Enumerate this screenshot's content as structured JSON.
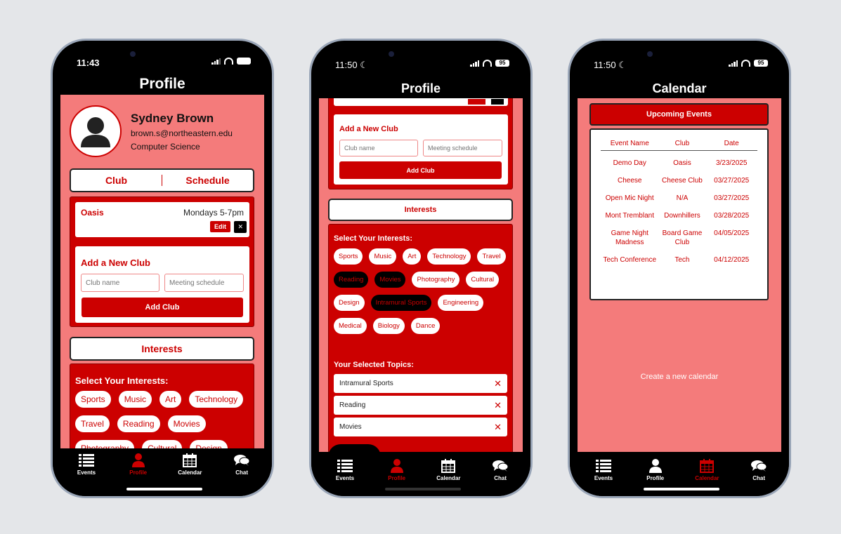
{
  "tabbar": [
    {
      "label": "Events",
      "icon": "list-icon"
    },
    {
      "label": "Profile",
      "icon": "person-icon"
    },
    {
      "label": "Calendar",
      "icon": "calendar-icon"
    },
    {
      "label": "Chat",
      "icon": "chat-icon"
    }
  ],
  "phone1": {
    "time": "11:43",
    "title": "Profile",
    "profile": {
      "name": "Sydney Brown",
      "email": "brown.s@northeastern.edu",
      "major": "Computer Science"
    },
    "segments": [
      "Club",
      "Schedule"
    ],
    "club": {
      "name": "Oasis",
      "schedule": "Mondays 5-7pm",
      "edit": "Edit",
      "delete": "✕"
    },
    "add_club": {
      "heading": "Add a New Club",
      "club_name_placeholder": "Club name",
      "schedule_placeholder": "Meeting schedule",
      "button": "Add Club"
    },
    "interests_button": "Interests",
    "select_heading": "Select Your Interests:",
    "chips": [
      "Sports",
      "Music",
      "Art",
      "Technology",
      "Travel",
      "Reading",
      "Movies",
      "Photography",
      "Cultural",
      "Design"
    ],
    "active_tab": "Profile"
  },
  "phone2": {
    "time": "11:50",
    "battery": "95",
    "title": "Profile",
    "add_club": {
      "heading": "Add a New Club",
      "club_name_placeholder": "Club name",
      "schedule_placeholder": "Meeting schedule",
      "button": "Add Club"
    },
    "interests_button": "Interests",
    "select_heading": "Select Your Interests:",
    "chips": [
      {
        "label": "Sports",
        "selected": false
      },
      {
        "label": "Music",
        "selected": false
      },
      {
        "label": "Art",
        "selected": false
      },
      {
        "label": "Technology",
        "selected": false
      },
      {
        "label": "Travel",
        "selected": false
      },
      {
        "label": "Reading",
        "selected": true
      },
      {
        "label": "Movies",
        "selected": true
      },
      {
        "label": "Photography",
        "selected": false
      },
      {
        "label": "Cultural",
        "selected": false
      },
      {
        "label": "Design",
        "selected": false
      },
      {
        "label": "Intramural Sports",
        "selected": true
      },
      {
        "label": "Engineering",
        "selected": false
      },
      {
        "label": "Medical",
        "selected": false
      },
      {
        "label": "Biology",
        "selected": false
      },
      {
        "label": "Dance",
        "selected": false
      }
    ],
    "selected_heading": "Your Selected Topics:",
    "selected_topics": [
      "Intramural Sports",
      "Reading",
      "Movies"
    ],
    "remove_icon": "✕",
    "active_tab": "Profile"
  },
  "phone3": {
    "time": "11:50",
    "battery": "95",
    "title": "Calendar",
    "upcoming_button": "Upcoming Events",
    "columns": [
      "Event Name",
      "Club",
      "Date"
    ],
    "events": [
      [
        "Demo Day",
        "Oasis",
        "3/23/2025"
      ],
      [
        "Cheese",
        "Cheese Club",
        "03/27/2025"
      ],
      [
        "Open Mic Night",
        "N/A",
        "03/27/2025"
      ],
      [
        "Mont Tremblant",
        "Downhillers",
        "03/28/2025"
      ],
      [
        "Game Night Madness",
        "Board Game Club",
        "04/05/2025"
      ],
      [
        "Tech Conference",
        "Tech",
        "04/12/2025"
      ]
    ],
    "create_link": "Create a new calendar",
    "active_tab": "Calendar"
  },
  "colors": {
    "red": "#cc0000",
    "pink": "#f47b7b",
    "black": "#000000"
  }
}
